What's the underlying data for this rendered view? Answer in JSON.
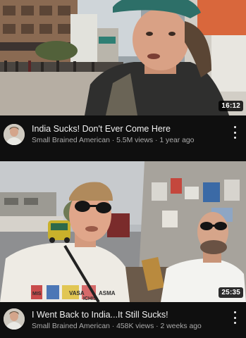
{
  "videos": [
    {
      "title": "India Sucks! Don't Ever Come Here",
      "channel": "Small Brained American",
      "views": "5.5M views",
      "age": "1 year ago",
      "duration": "16:12",
      "thumb_text": []
    },
    {
      "title": "I Went Back to India...It Still Sucks!",
      "channel": "Small Brained American",
      "views": "458K views",
      "age": "2 weeks ago",
      "duration": "25:35",
      "thumb_text": [
        "VASA",
        "MIS",
        "ICHIS",
        "ASMA"
      ]
    }
  ],
  "separator": " · ",
  "colors": {
    "background": "#0f0f0f",
    "title": "#f1f1f1",
    "subline": "#aaaaaa"
  },
  "icons": {
    "menu": "three-dots-vertical-icon",
    "avatar": "channel-avatar-icon"
  }
}
